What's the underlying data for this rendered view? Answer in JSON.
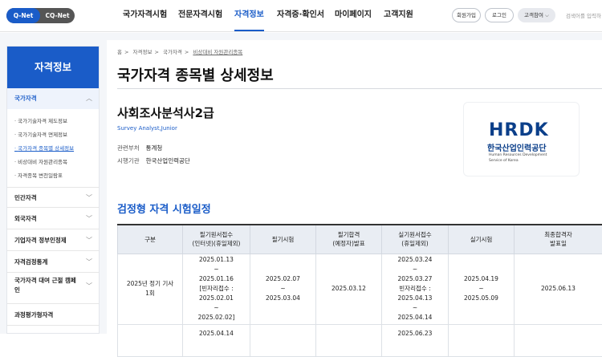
{
  "header": {
    "seg": [
      "Q-Net",
      "CQ-Net"
    ],
    "nav": [
      "국가자격시험",
      "전문자격시험",
      "자격정보",
      "자격증·확인서",
      "마이페이지",
      "고객지원"
    ],
    "buttons": [
      "회원가입",
      "로그인",
      "고객참여 ⌵"
    ],
    "search": "검색어를 입력하"
  },
  "sidebar": {
    "title": "자격정보",
    "active_category": "국가자격",
    "subitems": [
      "국가기술자격 제도정보",
      "국가기술자격 면제정보",
      "국가자격 종목별 상세정보",
      "비상대비 자원관리종목",
      "자격종목 변천일람표"
    ],
    "categories": [
      "민간자격",
      "외국자격",
      "기업자격 정부인정제",
      "자격검정통계",
      "국가자격 대여 근절 캠페인",
      "과정평가형자격"
    ]
  },
  "breadcrumb": [
    "홈",
    "자격정보",
    "국가자격",
    "비상대비 자원관리종목"
  ],
  "page": {
    "title": "국가자격 종목별 상세정보",
    "qual_name": "사회조사분석사2급",
    "qual_en": "Survey Analyst,Junior",
    "ministry_label": "관련부처",
    "ministry": "통계청",
    "agency_label": "시행기관",
    "agency": "한국산업인력공단",
    "section_title": "검정형 자격 시험일정"
  },
  "logo": {
    "mark": "HRDK",
    "kr": "한국산업인력공단",
    "en1": "Human Resources Development",
    "en2": "Service of Korea"
  },
  "table": {
    "headers": [
      "구분",
      "필기원서접수\n(인터넷)(휴일제외)",
      "필기시험",
      "필기합격\n(예정자)발표",
      "실기원서접수\n(휴일제외)",
      "실기시험",
      "최종합격자\n발표일"
    ],
    "rows": [
      [
        "2025년 정기 기사\n1회",
        "2025.01.13\n~\n2025.01.16\n[빈자리접수 :\n2025.02.01\n~\n2025.02.02]",
        "2025.02.07\n~\n2025.03.04",
        "2025.03.12",
        "2025.03.24\n~\n2025.03.27\n빈자리접수 :\n2025.04.13\n~\n2025.04.14",
        "2025.04.19\n~\n2025.05.09",
        "2025.06.13"
      ],
      [
        "",
        "2025.04.14",
        "",
        "",
        "2025.06.23",
        "",
        ""
      ]
    ]
  }
}
